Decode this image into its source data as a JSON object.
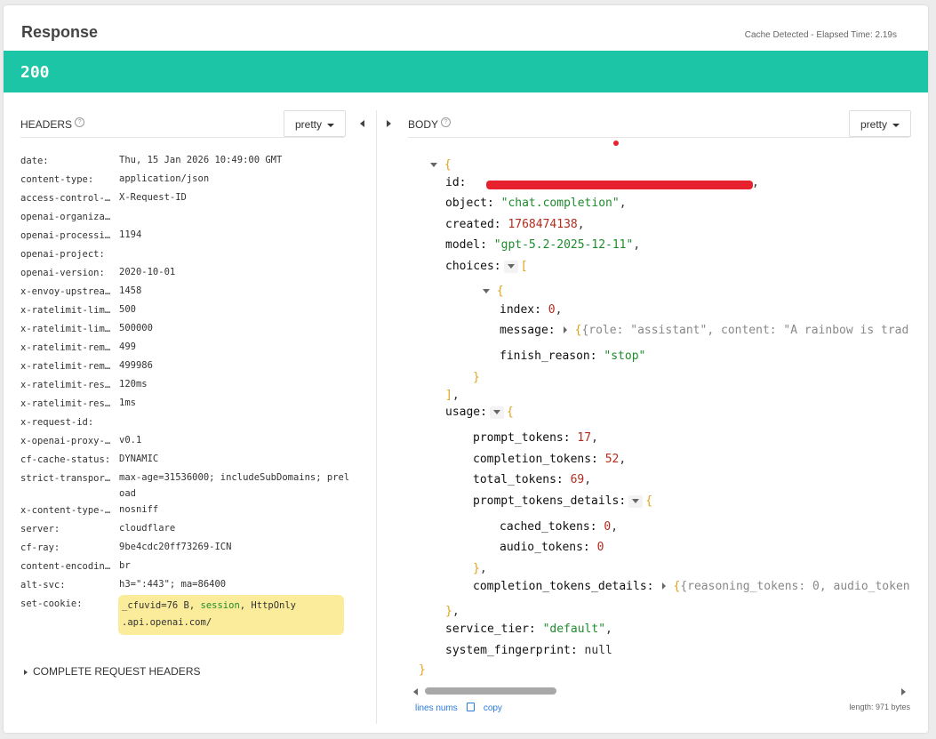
{
  "title": "Response",
  "cache_note": "Cache Detected - Elapsed Time: 2.19s",
  "status_code": "200",
  "headers_panel": {
    "label": "HEADERS",
    "help": "?",
    "format_label": "pretty",
    "rows": [
      {
        "key": "date:",
        "value": "Thu, 15 Jan 2026 10:49:00 GMT"
      },
      {
        "key": "content-type:",
        "value": "application/json"
      },
      {
        "key": "access-control-…",
        "value": "X-Request-ID"
      },
      {
        "key": "openai-organiza…",
        "value": ""
      },
      {
        "key": "openai-processi…",
        "value": "1194"
      },
      {
        "key": "openai-project:",
        "value": ""
      },
      {
        "key": "openai-version:",
        "value": "2020-10-01"
      },
      {
        "key": "x-envoy-upstrea…",
        "value": "1458"
      },
      {
        "key": "x-ratelimit-lim…",
        "value": "500"
      },
      {
        "key": "x-ratelimit-lim…",
        "value": "500000"
      },
      {
        "key": "x-ratelimit-rem…",
        "value": "499"
      },
      {
        "key": "x-ratelimit-rem…",
        "value": "499986"
      },
      {
        "key": "x-ratelimit-res…",
        "value": "120ms"
      },
      {
        "key": "x-ratelimit-res…",
        "value": "1ms"
      },
      {
        "key": "x-request-id:",
        "value": ""
      },
      {
        "key": "x-openai-proxy-…",
        "value": "v0.1"
      },
      {
        "key": "cf-cache-status:",
        "value": "DYNAMIC"
      },
      {
        "key": "strict-transpor…",
        "value": "max-age=31536000; includeSubDomains; preload"
      },
      {
        "key": "x-content-type-…",
        "value": "nosniff"
      },
      {
        "key": "server:",
        "value": "cloudflare"
      },
      {
        "key": "cf-ray:",
        "value": "9be4cdc20ff73269-ICN"
      },
      {
        "key": "content-encodin…",
        "value": "br"
      },
      {
        "key": "alt-svc:",
        "value": "h3=\":443\"; ma=86400"
      }
    ],
    "set_cookie": {
      "key": "set-cookie:",
      "part1": "_cfuvid=76 B, ",
      "kw": "session",
      "part2": ", HttpOnly",
      "line2": ".api.openai.com/"
    },
    "complete_request_label": "COMPLETE REQUEST HEADERS"
  },
  "body_panel": {
    "label": "BODY",
    "help": "?",
    "format_label": "pretty",
    "json": {
      "open_brace": "{",
      "id_key": "id:",
      "object_key": "object:",
      "object_val": "\"chat.completion\"",
      "created_key": "created:",
      "created_val": "1768474138",
      "model_key": "model:",
      "model_val": "\"gpt-5.2-2025-12-11\"",
      "choices_key": "choices:",
      "index_key": "index:",
      "index_val": "0",
      "message_key": "message:",
      "message_preview": "{role:  \"assistant\", content:  \"A rainbow is trad",
      "finish_key": "finish_reason:",
      "finish_val": "\"stop\"",
      "usage_key": "usage:",
      "prompt_tokens_key": "prompt_tokens:",
      "prompt_tokens_val": "17",
      "completion_tokens_key": "completion_tokens:",
      "completion_tokens_val": "52",
      "total_tokens_key": "total_tokens:",
      "total_tokens_val": "69",
      "ptd_key": "prompt_tokens_details:",
      "cached_tokens_key": "cached_tokens:",
      "cached_tokens_val": "0",
      "audio_tokens_key": "audio_tokens:",
      "audio_tokens_val": "0",
      "ctd_key": "completion_tokens_details:",
      "ctd_preview": "{reasoning_tokens:  0, audio_tokens",
      "service_tier_key": "service_tier:",
      "service_tier_val": "\"default\"",
      "fingerprint_key": "system_fingerprint:",
      "fingerprint_val": "null"
    },
    "footer": {
      "lines_nums": "lines nums",
      "copy": "copy",
      "length": "length: 971 bytes"
    }
  },
  "colors": {
    "status_bar": "#1bc5a6",
    "string": "#1e8c2d",
    "number": "#b32c1d",
    "bracket": "#e0a21a",
    "highlight": "#fbec9c"
  }
}
